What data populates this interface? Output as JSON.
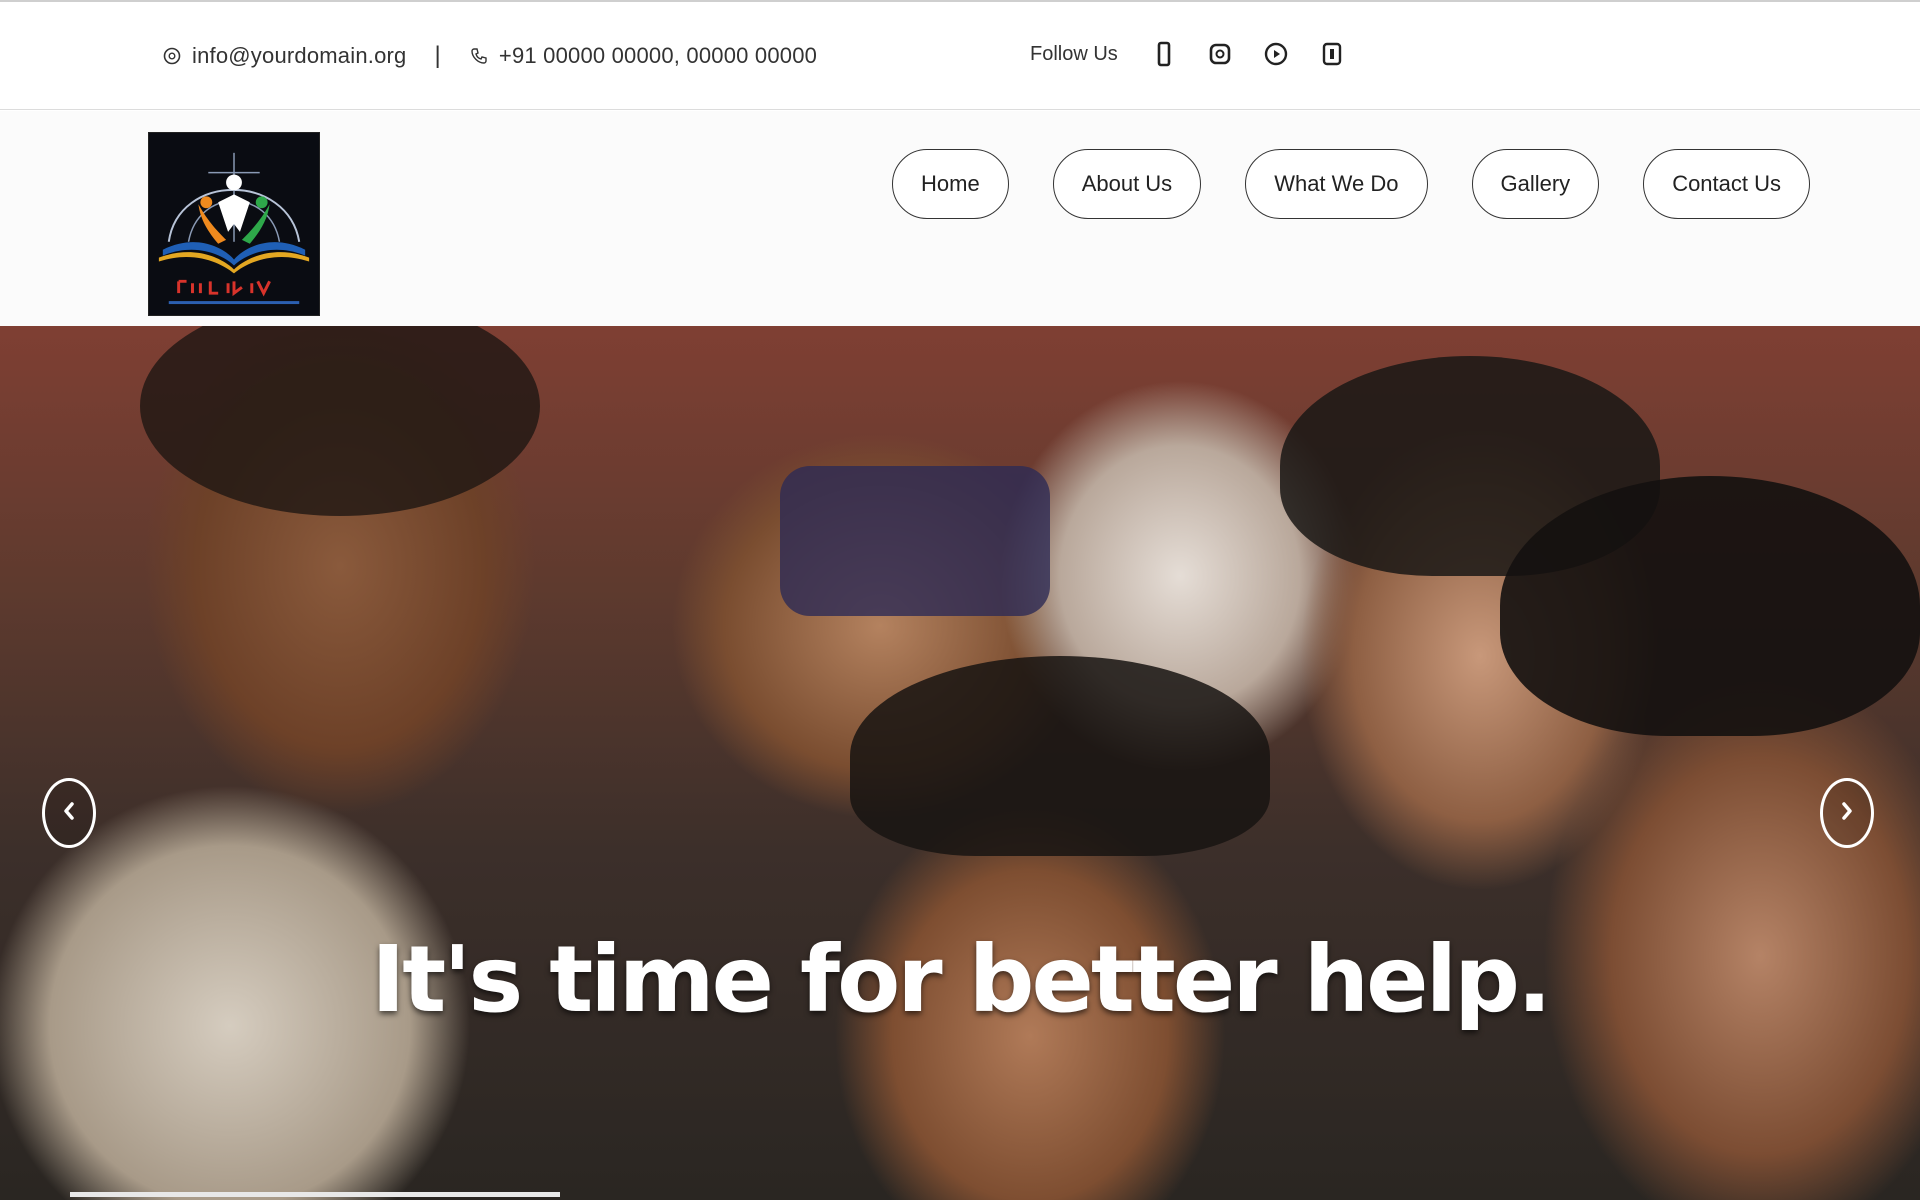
{
  "topbar": {
    "email": "info@yourdomain.org",
    "separator": "|",
    "phone": "+91 00000 00000, 00000 00000",
    "follow_label": "Follow Us",
    "social": [
      "facebook-icon",
      "instagram-icon",
      "youtube-icon",
      "linkedin-icon"
    ]
  },
  "header": {
    "logo_text": "",
    "nav": [
      "Home",
      "About Us",
      "What We Do",
      "Gallery",
      "Contact Us"
    ]
  },
  "hero": {
    "headline": "It's time for better help."
  },
  "colors": {
    "text_dark": "#222222",
    "border": "#333333",
    "hero_text": "#ffffff"
  }
}
